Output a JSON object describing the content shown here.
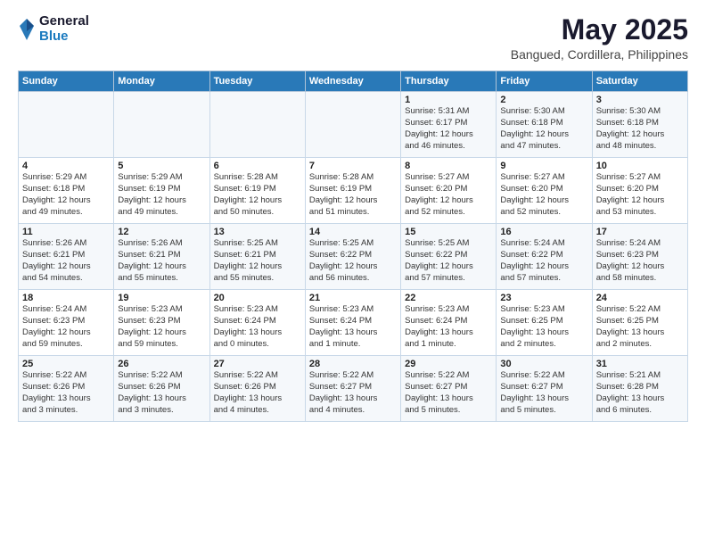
{
  "logo": {
    "general": "General",
    "blue": "Blue"
  },
  "title": "May 2025",
  "subtitle": "Bangued, Cordillera, Philippines",
  "weekdays": [
    "Sunday",
    "Monday",
    "Tuesday",
    "Wednesday",
    "Thursday",
    "Friday",
    "Saturday"
  ],
  "weeks": [
    [
      {
        "day": "",
        "info": ""
      },
      {
        "day": "",
        "info": ""
      },
      {
        "day": "",
        "info": ""
      },
      {
        "day": "",
        "info": ""
      },
      {
        "day": "1",
        "info": "Sunrise: 5:31 AM\nSunset: 6:17 PM\nDaylight: 12 hours\nand 46 minutes."
      },
      {
        "day": "2",
        "info": "Sunrise: 5:30 AM\nSunset: 6:18 PM\nDaylight: 12 hours\nand 47 minutes."
      },
      {
        "day": "3",
        "info": "Sunrise: 5:30 AM\nSunset: 6:18 PM\nDaylight: 12 hours\nand 48 minutes."
      }
    ],
    [
      {
        "day": "4",
        "info": "Sunrise: 5:29 AM\nSunset: 6:18 PM\nDaylight: 12 hours\nand 49 minutes."
      },
      {
        "day": "5",
        "info": "Sunrise: 5:29 AM\nSunset: 6:19 PM\nDaylight: 12 hours\nand 49 minutes."
      },
      {
        "day": "6",
        "info": "Sunrise: 5:28 AM\nSunset: 6:19 PM\nDaylight: 12 hours\nand 50 minutes."
      },
      {
        "day": "7",
        "info": "Sunrise: 5:28 AM\nSunset: 6:19 PM\nDaylight: 12 hours\nand 51 minutes."
      },
      {
        "day": "8",
        "info": "Sunrise: 5:27 AM\nSunset: 6:20 PM\nDaylight: 12 hours\nand 52 minutes."
      },
      {
        "day": "9",
        "info": "Sunrise: 5:27 AM\nSunset: 6:20 PM\nDaylight: 12 hours\nand 52 minutes."
      },
      {
        "day": "10",
        "info": "Sunrise: 5:27 AM\nSunset: 6:20 PM\nDaylight: 12 hours\nand 53 minutes."
      }
    ],
    [
      {
        "day": "11",
        "info": "Sunrise: 5:26 AM\nSunset: 6:21 PM\nDaylight: 12 hours\nand 54 minutes."
      },
      {
        "day": "12",
        "info": "Sunrise: 5:26 AM\nSunset: 6:21 PM\nDaylight: 12 hours\nand 55 minutes."
      },
      {
        "day": "13",
        "info": "Sunrise: 5:25 AM\nSunset: 6:21 PM\nDaylight: 12 hours\nand 55 minutes."
      },
      {
        "day": "14",
        "info": "Sunrise: 5:25 AM\nSunset: 6:22 PM\nDaylight: 12 hours\nand 56 minutes."
      },
      {
        "day": "15",
        "info": "Sunrise: 5:25 AM\nSunset: 6:22 PM\nDaylight: 12 hours\nand 57 minutes."
      },
      {
        "day": "16",
        "info": "Sunrise: 5:24 AM\nSunset: 6:22 PM\nDaylight: 12 hours\nand 57 minutes."
      },
      {
        "day": "17",
        "info": "Sunrise: 5:24 AM\nSunset: 6:23 PM\nDaylight: 12 hours\nand 58 minutes."
      }
    ],
    [
      {
        "day": "18",
        "info": "Sunrise: 5:24 AM\nSunset: 6:23 PM\nDaylight: 12 hours\nand 59 minutes."
      },
      {
        "day": "19",
        "info": "Sunrise: 5:23 AM\nSunset: 6:23 PM\nDaylight: 12 hours\nand 59 minutes."
      },
      {
        "day": "20",
        "info": "Sunrise: 5:23 AM\nSunset: 6:24 PM\nDaylight: 13 hours\nand 0 minutes."
      },
      {
        "day": "21",
        "info": "Sunrise: 5:23 AM\nSunset: 6:24 PM\nDaylight: 13 hours\nand 1 minute."
      },
      {
        "day": "22",
        "info": "Sunrise: 5:23 AM\nSunset: 6:24 PM\nDaylight: 13 hours\nand 1 minute."
      },
      {
        "day": "23",
        "info": "Sunrise: 5:23 AM\nSunset: 6:25 PM\nDaylight: 13 hours\nand 2 minutes."
      },
      {
        "day": "24",
        "info": "Sunrise: 5:22 AM\nSunset: 6:25 PM\nDaylight: 13 hours\nand 2 minutes."
      }
    ],
    [
      {
        "day": "25",
        "info": "Sunrise: 5:22 AM\nSunset: 6:26 PM\nDaylight: 13 hours\nand 3 minutes."
      },
      {
        "day": "26",
        "info": "Sunrise: 5:22 AM\nSunset: 6:26 PM\nDaylight: 13 hours\nand 3 minutes."
      },
      {
        "day": "27",
        "info": "Sunrise: 5:22 AM\nSunset: 6:26 PM\nDaylight: 13 hours\nand 4 minutes."
      },
      {
        "day": "28",
        "info": "Sunrise: 5:22 AM\nSunset: 6:27 PM\nDaylight: 13 hours\nand 4 minutes."
      },
      {
        "day": "29",
        "info": "Sunrise: 5:22 AM\nSunset: 6:27 PM\nDaylight: 13 hours\nand 5 minutes."
      },
      {
        "day": "30",
        "info": "Sunrise: 5:22 AM\nSunset: 6:27 PM\nDaylight: 13 hours\nand 5 minutes."
      },
      {
        "day": "31",
        "info": "Sunrise: 5:21 AM\nSunset: 6:28 PM\nDaylight: 13 hours\nand 6 minutes."
      }
    ]
  ]
}
